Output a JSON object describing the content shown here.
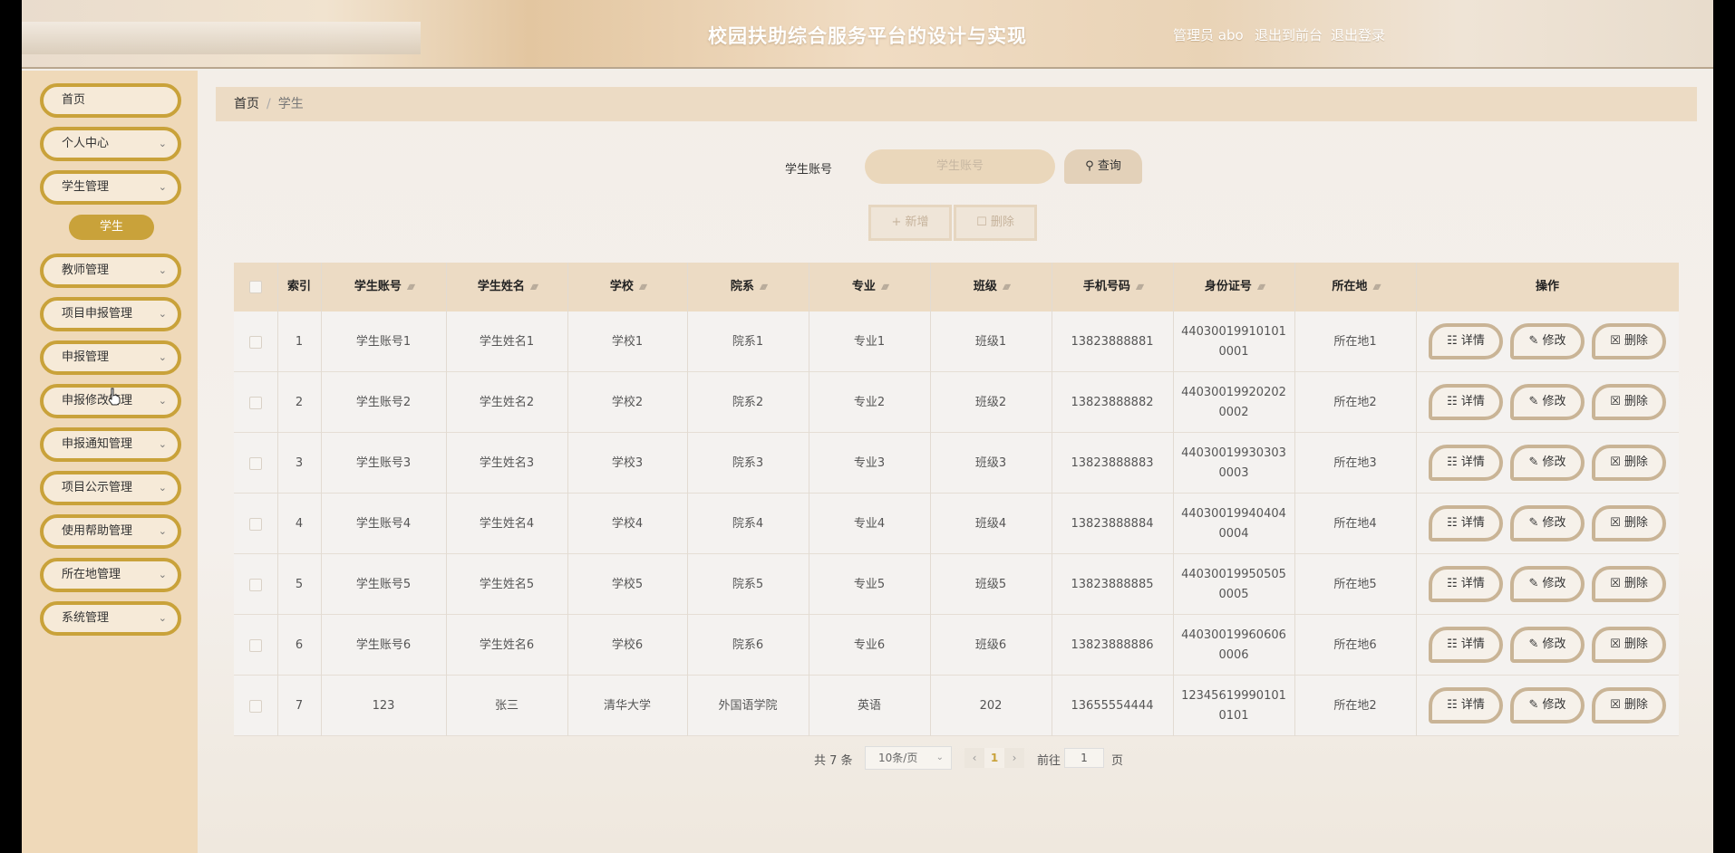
{
  "header": {
    "title": "校园扶助综合服务平台的设计与实现",
    "admin": "管理员 abo",
    "back_front": "退出到前台",
    "logout": "退出登录"
  },
  "sidebar": {
    "items": [
      {
        "label": "首页"
      },
      {
        "label": "个人中心"
      },
      {
        "label": "学生管理"
      },
      {
        "label": "教师管理"
      },
      {
        "label": "项目申报管理"
      },
      {
        "label": "申报管理"
      },
      {
        "label": "申报修改管理"
      },
      {
        "label": "申报通知管理"
      },
      {
        "label": "项目公示管理"
      },
      {
        "label": "使用帮助管理"
      },
      {
        "label": "所在地管理"
      },
      {
        "label": "系统管理"
      }
    ],
    "active_sub": "学生"
  },
  "breadcrumb": {
    "home": "首页",
    "sep": "/",
    "current": "学生"
  },
  "search": {
    "label": "学生账号",
    "placeholder": "学生账号",
    "button": "查询"
  },
  "actions": {
    "add": "新增",
    "delete": "删除"
  },
  "table": {
    "columns": [
      "索引",
      "学生账号",
      "学生姓名",
      "学校",
      "院系",
      "专业",
      "班级",
      "手机号码",
      "身份证号",
      "所在地",
      "操作"
    ],
    "rows": [
      [
        "1",
        "学生账号1",
        "学生姓名1",
        "学校1",
        "院系1",
        "专业1",
        "班级1",
        "13823888881",
        "44030019910101\n0001",
        "所在地1"
      ],
      [
        "2",
        "学生账号2",
        "学生姓名2",
        "学校2",
        "院系2",
        "专业2",
        "班级2",
        "13823888882",
        "44030019920202\n0002",
        "所在地2"
      ],
      [
        "3",
        "学生账号3",
        "学生姓名3",
        "学校3",
        "院系3",
        "专业3",
        "班级3",
        "13823888883",
        "44030019930303\n0003",
        "所在地3"
      ],
      [
        "4",
        "学生账号4",
        "学生姓名4",
        "学校4",
        "院系4",
        "专业4",
        "班级4",
        "13823888884",
        "44030019940404\n0004",
        "所在地4"
      ],
      [
        "5",
        "学生账号5",
        "学生姓名5",
        "学校5",
        "院系5",
        "专业5",
        "班级5",
        "13823888885",
        "44030019950505\n0005",
        "所在地5"
      ],
      [
        "6",
        "学生账号6",
        "学生姓名6",
        "学校6",
        "院系6",
        "专业6",
        "班级6",
        "13823888886",
        "44030019960606\n0006",
        "所在地6"
      ],
      [
        "7",
        "123",
        "张三",
        "清华大学",
        "外国语学院",
        "英语",
        "202",
        "13655554444",
        "12345619990101\n0101",
        "所在地2"
      ]
    ],
    "ops": {
      "detail": "详情",
      "edit": "修改",
      "del": "删除"
    }
  },
  "pagination": {
    "total": "共 7 条",
    "page_size": "10条/页",
    "current": "1",
    "goto_label": "前往",
    "goto_value": "1",
    "page_suffix": "页"
  },
  "colors": {
    "accent": "#c9a23a",
    "header_bg": "#ecdbc4",
    "sidebar_bg": "#efd9b9"
  }
}
